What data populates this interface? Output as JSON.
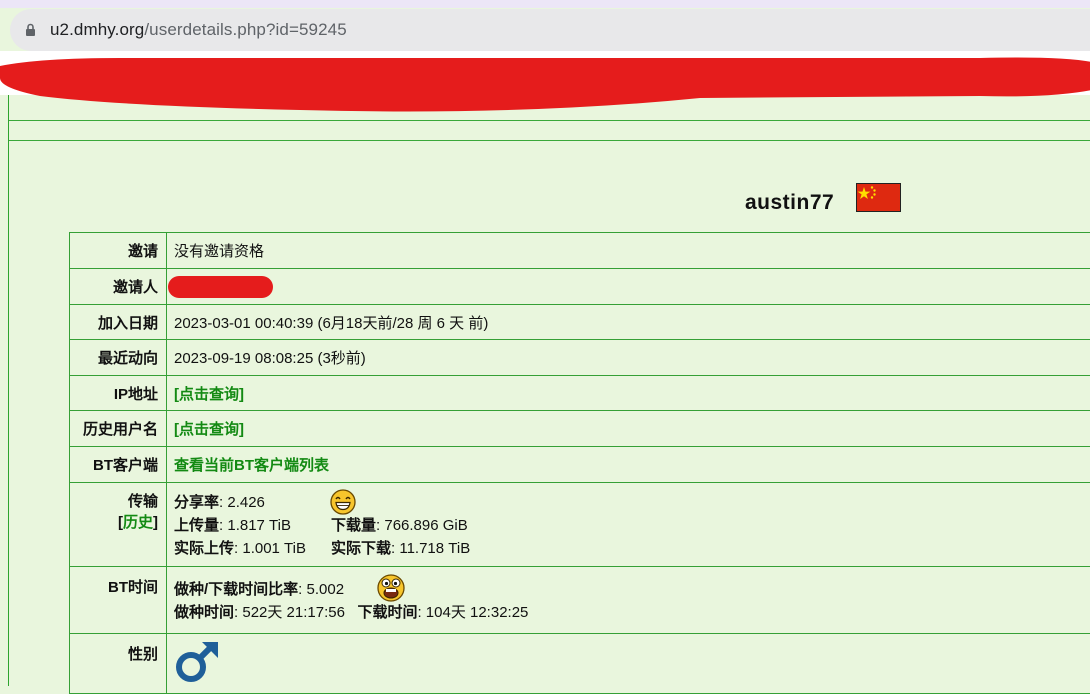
{
  "browser": {
    "url_host": "u2.dmhy.org",
    "url_path": "/userdetails.php?id=59245"
  },
  "user": {
    "name": "austin77",
    "flag_icon": "china-flag-icon"
  },
  "rows": {
    "invite": {
      "label": "邀请",
      "value": "没有邀请资格"
    },
    "inviter": {
      "label": "邀请人"
    },
    "join_date": {
      "label": "加入日期",
      "value": "2023-03-01 00:40:39 (6月18天前/28 周 6 天 前)"
    },
    "last_action": {
      "label": "最近动向",
      "value": "2023-09-19 08:08:25 (3秒前)"
    },
    "ip": {
      "label": "IP地址",
      "link": "[点击查询]"
    },
    "history_names": {
      "label": "历史用户名",
      "link": "[点击查询]"
    },
    "bt_client": {
      "label": "BT客户端",
      "link": "查看当前BT客户端列表"
    },
    "transfer": {
      "label": "传输",
      "history_open": "[",
      "history_link": "历史",
      "history_close": "]",
      "ratio_label": "分享率",
      "ratio": ": 2.426",
      "uploaded_label": "上传量",
      "uploaded": ": 1.817 TiB",
      "downloaded_label": "下载量",
      "downloaded": ": 766.896 GiB",
      "real_up_label": "实际上传",
      "real_up": ": 1.001 TiB",
      "real_down_label": "实际下载",
      "real_down": ": 11.718 TiB",
      "emoji": "grin-smiley-icon"
    },
    "bt_time": {
      "label": "BT时间",
      "ratio_label": "做种/下载时间比率",
      "ratio": ": 5.002",
      "seed_label": "做种时间",
      "seed": ": 522天 21:17:56",
      "leech_label": "下载时间",
      "leech": ": 104天 12:32:25",
      "emoji": "excited-smiley-icon"
    },
    "gender": {
      "label": "性别",
      "icon": "male-symbol-icon",
      "color": "#1f5f99"
    }
  }
}
